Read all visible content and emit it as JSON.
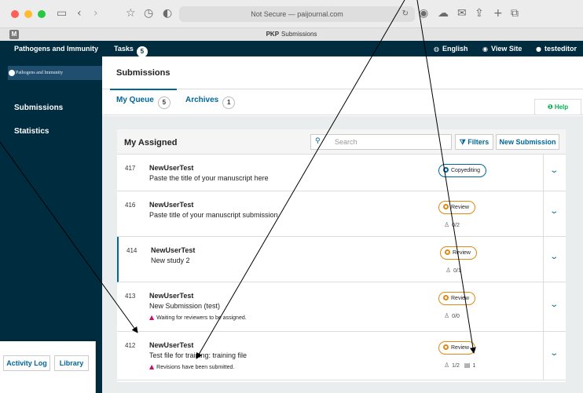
{
  "browser": {
    "address": "Not Secure — paijournal.com",
    "tab_favicon": "M",
    "tab_title_prefix": "PKP",
    "tab_title": "Submissions"
  },
  "topbar": {
    "context": "Pathogens and Immunity",
    "tasks_label": "Tasks",
    "tasks_count": "5",
    "language": "English",
    "view_site": "View Site",
    "user": "testeditor"
  },
  "sidebar": {
    "logo_text": "Pathogens and Immunity",
    "items": [
      "Submissions",
      "Statistics"
    ]
  },
  "page": {
    "title": "Submissions",
    "tabs": [
      {
        "label": "My Queue",
        "count": "5"
      },
      {
        "label": "Archives",
        "count": "1"
      }
    ],
    "help": "Help"
  },
  "panel": {
    "title": "My Assigned",
    "search_placeholder": "Search",
    "filters": "Filters",
    "new_submission": "New Submission"
  },
  "submissions": [
    {
      "id": "417",
      "author": "NewUserTest",
      "title": "Paste the title of your manuscript here",
      "stage": "Copyediting",
      "warning": "",
      "reviews": "",
      "files": ""
    },
    {
      "id": "416",
      "author": "NewUserTest",
      "title": "Paste title of your manuscript submission",
      "stage": "Review",
      "warning": "",
      "reviews": "0/2",
      "files": ""
    },
    {
      "id": "414",
      "author": "NewUserTest",
      "title": "New study 2",
      "stage": "Review",
      "warning": "",
      "reviews": "0/1",
      "files": ""
    },
    {
      "id": "413",
      "author": "NewUserTest",
      "title": "New Submission (test)",
      "stage": "Review",
      "warning": "Waiting for reviewers to be assigned.",
      "reviews": "0/0",
      "files": ""
    },
    {
      "id": "412",
      "author": "NewUserTest",
      "title": "Test file for training: training file",
      "stage": "Review",
      "warning": "Revisions have been submitted.",
      "reviews": "1/2",
      "files": "1"
    }
  ],
  "floating": {
    "activity_log": "Activity Log",
    "library": "Library"
  },
  "colors": {
    "header": "#002c40",
    "link": "#006798",
    "review": "#e08914",
    "warning": "#d00a6c",
    "help": "#00b24e"
  }
}
